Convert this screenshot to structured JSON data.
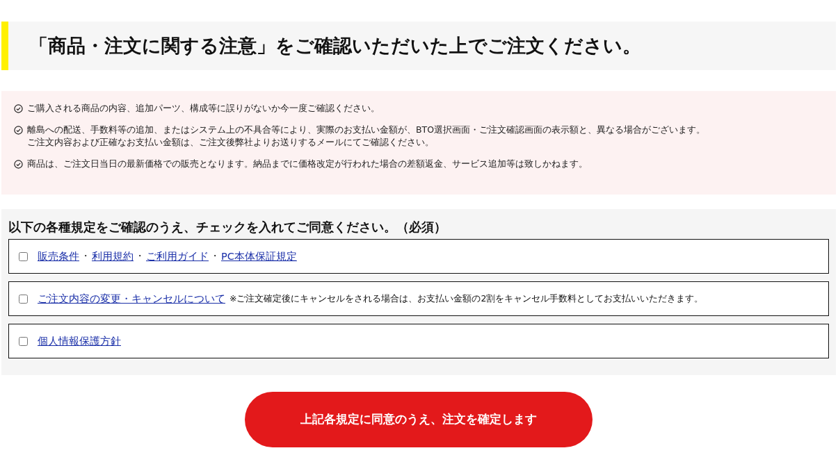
{
  "heading": "「商品・注文に関する注意」をご確認いただいた上でご注文ください。",
  "notices": [
    {
      "lines": [
        "ご購入される商品の内容、追加パーツ、構成等に誤りがないか今一度ご確認ください。"
      ]
    },
    {
      "lines": [
        "離島への配送、手数料等の追加、またはシステム上の不具合等により、実際のお支払い金額が、BTO選択画面・ご注文確認画面の表示額と、異なる場合がございます。",
        "ご注文内容および正確なお支払い金額は、ご注文後弊社よりお送りするメールにてご確認ください。"
      ]
    },
    {
      "lines": [
        "商品は、ご注文日当日の最新価格での販売となります。納品までに価格改定が行われた場合の差額返金、サービス追加等は致しかねます。"
      ]
    }
  ],
  "agreement": {
    "title": "以下の各種規定をご確認のうえ、チェックを入れてご同意ください。（必須）",
    "items": [
      {
        "checked": false,
        "parts": [
          {
            "kind": "link",
            "text": "販売条件"
          },
          {
            "kind": "separator",
            "text": "・"
          },
          {
            "kind": "link",
            "text": "利用規約"
          },
          {
            "kind": "separator",
            "text": "・"
          },
          {
            "kind": "link",
            "text": "ご利用ガイド"
          },
          {
            "kind": "separator",
            "text": "・"
          },
          {
            "kind": "link",
            "text": "PC本体保証規定"
          }
        ]
      },
      {
        "checked": false,
        "parts": [
          {
            "kind": "link",
            "text": "ご注文内容の変更・キャンセルについて"
          },
          {
            "kind": "note",
            "text": "※ご注文確定後にキャンセルをされる場合は、お支払い金額の2割をキャンセル手数料としてお支払いいただきます。"
          }
        ]
      },
      {
        "checked": false,
        "parts": [
          {
            "kind": "link",
            "text": "個人情報保護方針"
          }
        ]
      }
    ]
  },
  "confirm_button": "上記各規定に同意のうえ、注文を確定します"
}
